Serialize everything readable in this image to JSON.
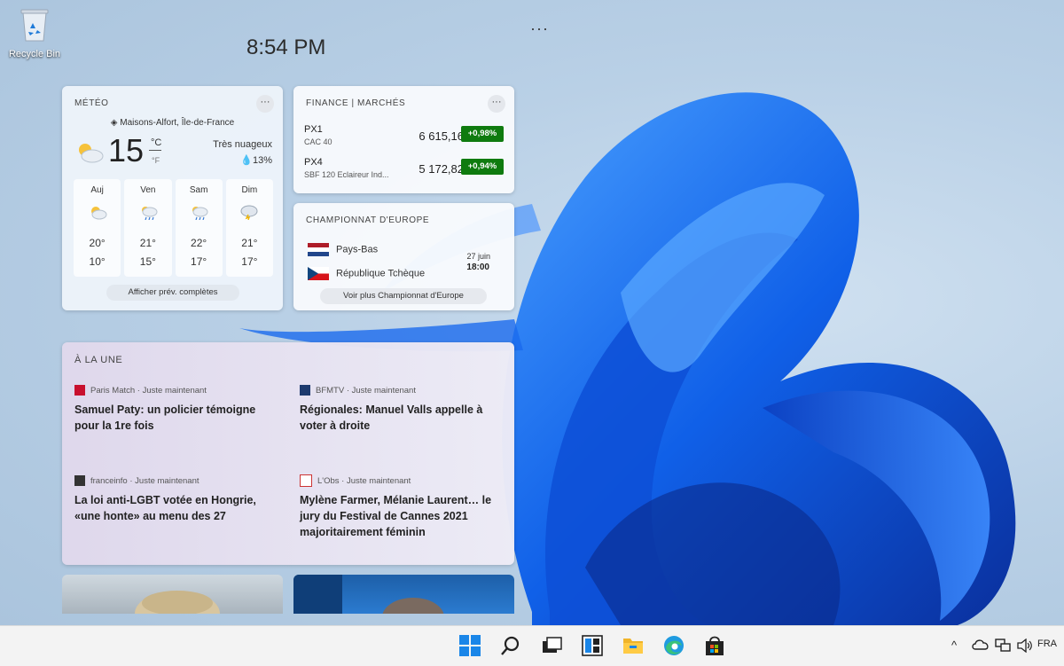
{
  "desktop": {
    "recycle_bin_label": "Recycle Bin"
  },
  "clock": "8:54 PM",
  "weather": {
    "title": "MÉTÉO",
    "more": "···",
    "location": "Maisons-Alfort, Île-de-France",
    "temperature": "15",
    "unit_c": "°C",
    "unit_f": "°F",
    "condition": "Très nuageux",
    "humidity": "13%",
    "forecast": [
      {
        "day": "Auj",
        "high": "20°",
        "low": "10°",
        "icon": "partly-sunny-icon"
      },
      {
        "day": "Ven",
        "high": "21°",
        "low": "15°",
        "icon": "rain-showers-icon"
      },
      {
        "day": "Sam",
        "high": "22°",
        "low": "17°",
        "icon": "rain-showers-icon"
      },
      {
        "day": "Dim",
        "high": "21°",
        "low": "17°",
        "icon": "thunderstorm-icon"
      }
    ],
    "link": "Afficher prév. complètes"
  },
  "finance": {
    "title": "FINANCE | MARCHÉS",
    "more": "···",
    "stocks": [
      {
        "symbol": "PX1",
        "name": "CAC 40",
        "price": "6 615,16",
        "change": "+0,98%"
      },
      {
        "symbol": "PX4",
        "name": "SBF 120 Eclaireur Ind...",
        "price": "5 172,82",
        "change": "+0,94%"
      }
    ],
    "positive_color": "#0f7b0f"
  },
  "sports": {
    "title": "CHAMPIONNAT D'EUROPE",
    "team1": "Pays-Bas",
    "team2": "République Tchèque",
    "date": "27 juin",
    "time": "18:00",
    "link": "Voir plus Championnat d'Europe"
  },
  "news": {
    "title": "À LA UNE",
    "articles": [
      {
        "source": "Paris Match · Juste maintenant",
        "headline": "Samuel Paty: un policier témoigne pour la 1re fois"
      },
      {
        "source": "BFMTV · Juste maintenant",
        "headline": "Régionales: Manuel Valls appelle à voter à droite"
      },
      {
        "source": "franceinfo · Juste maintenant",
        "headline": "La loi anti-LGBT votée en Hongrie, «une honte» au menu des 27"
      },
      {
        "source": "L'Obs · Juste maintenant",
        "headline": "Mylène Farmer, Mélanie Laurent… le jury du Festival de Cannes 2021 majoritairement féminin"
      }
    ]
  },
  "taskbar": {
    "apps": [
      "start-icon",
      "search-icon",
      "task-view-icon",
      "widgets-icon",
      "file-explorer-icon",
      "edge-icon",
      "store-icon"
    ],
    "language": "FRA",
    "tray_chevron": "^"
  },
  "top_more": "···"
}
